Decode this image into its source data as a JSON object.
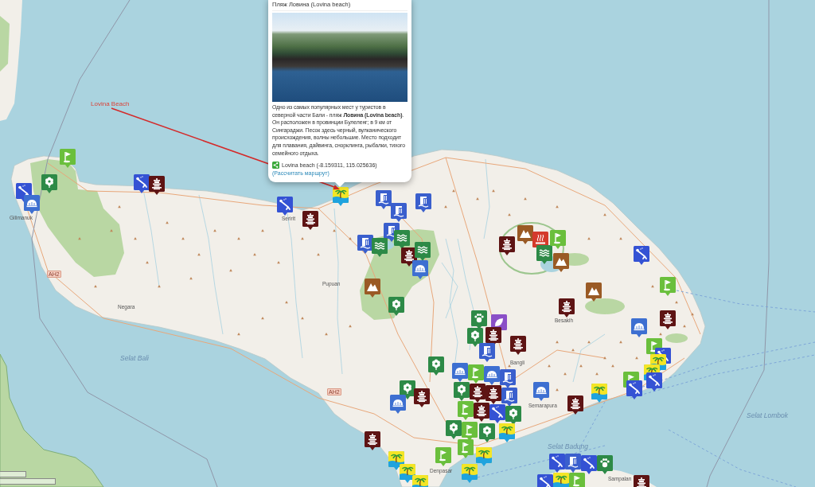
{
  "popup": {
    "title": "Пляж Ловина (Lovina beach)",
    "description": "Одно из самых популярных мест у туристов в северной части Бали - пляж **Ловина (Lovina beach)**. Он расположен в провинции Булеленг; в 9 км от Сингараджи. Песок здесь черный, вулканического происхождения, волны небольшие. Место подходит для плавания, дайвинга, снорклинга, рыбалки, тихого семейного отдыха.",
    "location": "Lovina beach (-8.159311, 115.025636)",
    "route_link": "(Рассчитать маршрут)"
  },
  "annotation": {
    "label": "Lovina Beach"
  },
  "map": {
    "labels": [
      {
        "kind": "town",
        "text": "Gilimanuk"
      },
      {
        "kind": "town",
        "text": "Seririt"
      },
      {
        "kind": "road",
        "text": "AH2"
      },
      {
        "kind": "town",
        "text": "Pupuan"
      },
      {
        "kind": "town",
        "text": "Negara"
      },
      {
        "kind": "town",
        "text": "Besakih"
      },
      {
        "kind": "sea",
        "text": "Selat Bali"
      },
      {
        "kind": "town",
        "text": "Bangli"
      },
      {
        "kind": "road",
        "text": "AH2"
      },
      {
        "kind": "town",
        "text": "Semarapura"
      },
      {
        "kind": "sea",
        "text": "Selat Lombok"
      },
      {
        "kind": "sea",
        "text": "Selat Badung"
      },
      {
        "kind": "town",
        "text": "Denpasar"
      },
      {
        "kind": "town",
        "text": "Sampalan"
      }
    ]
  }
}
